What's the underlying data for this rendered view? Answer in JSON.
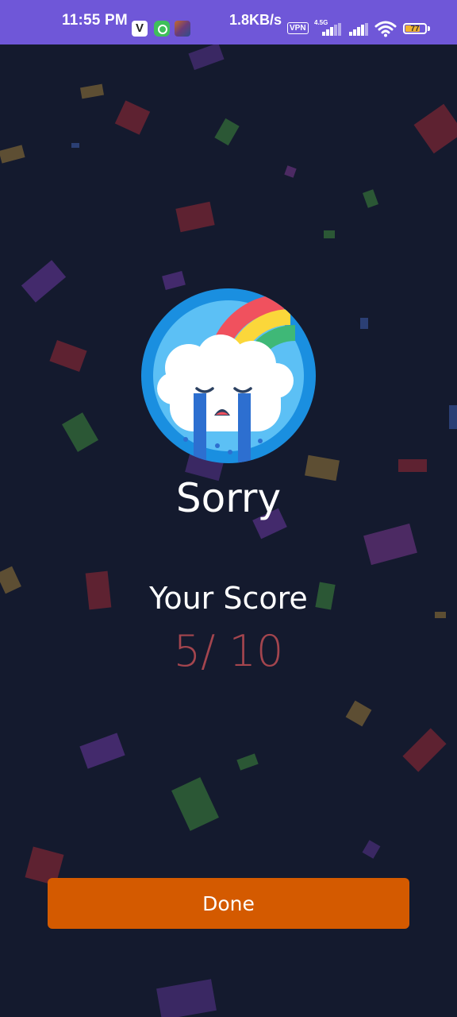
{
  "status_bar": {
    "time": "11:55 PM",
    "app_icon_v": "V",
    "net_speed": "1.8KB/s",
    "vpn_label": "VPN",
    "network_type": "4.5G",
    "battery_level": "77",
    "battery_fraction": 0.77,
    "battery_color": "#f0b232",
    "bar_color": "#6f57d8"
  },
  "result": {
    "emoji_icon": "crying-rainbow-cloud-icon",
    "title": "Sorry",
    "score_label": "Your Score",
    "score_value": "5/ 10"
  },
  "actions": {
    "done_label": "Done",
    "done_color": "#d45a00"
  },
  "theme": {
    "background": "#141a2e",
    "score_color": "#a4454e"
  }
}
